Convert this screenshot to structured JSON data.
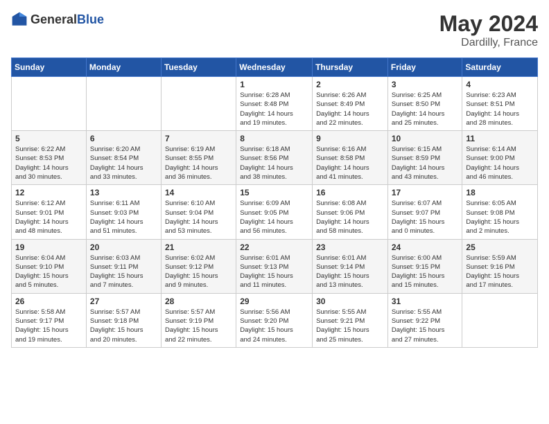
{
  "logo": {
    "general": "General",
    "blue": "Blue"
  },
  "title": {
    "month": "May 2024",
    "location": "Dardilly, France"
  },
  "weekdays": [
    "Sunday",
    "Monday",
    "Tuesday",
    "Wednesday",
    "Thursday",
    "Friday",
    "Saturday"
  ],
  "weeks": [
    [
      {
        "day": "",
        "info": ""
      },
      {
        "day": "",
        "info": ""
      },
      {
        "day": "",
        "info": ""
      },
      {
        "day": "1",
        "info": "Sunrise: 6:28 AM\nSunset: 8:48 PM\nDaylight: 14 hours\nand 19 minutes."
      },
      {
        "day": "2",
        "info": "Sunrise: 6:26 AM\nSunset: 8:49 PM\nDaylight: 14 hours\nand 22 minutes."
      },
      {
        "day": "3",
        "info": "Sunrise: 6:25 AM\nSunset: 8:50 PM\nDaylight: 14 hours\nand 25 minutes."
      },
      {
        "day": "4",
        "info": "Sunrise: 6:23 AM\nSunset: 8:51 PM\nDaylight: 14 hours\nand 28 minutes."
      }
    ],
    [
      {
        "day": "5",
        "info": "Sunrise: 6:22 AM\nSunset: 8:53 PM\nDaylight: 14 hours\nand 30 minutes."
      },
      {
        "day": "6",
        "info": "Sunrise: 6:20 AM\nSunset: 8:54 PM\nDaylight: 14 hours\nand 33 minutes."
      },
      {
        "day": "7",
        "info": "Sunrise: 6:19 AM\nSunset: 8:55 PM\nDaylight: 14 hours\nand 36 minutes."
      },
      {
        "day": "8",
        "info": "Sunrise: 6:18 AM\nSunset: 8:56 PM\nDaylight: 14 hours\nand 38 minutes."
      },
      {
        "day": "9",
        "info": "Sunrise: 6:16 AM\nSunset: 8:58 PM\nDaylight: 14 hours\nand 41 minutes."
      },
      {
        "day": "10",
        "info": "Sunrise: 6:15 AM\nSunset: 8:59 PM\nDaylight: 14 hours\nand 43 minutes."
      },
      {
        "day": "11",
        "info": "Sunrise: 6:14 AM\nSunset: 9:00 PM\nDaylight: 14 hours\nand 46 minutes."
      }
    ],
    [
      {
        "day": "12",
        "info": "Sunrise: 6:12 AM\nSunset: 9:01 PM\nDaylight: 14 hours\nand 48 minutes."
      },
      {
        "day": "13",
        "info": "Sunrise: 6:11 AM\nSunset: 9:03 PM\nDaylight: 14 hours\nand 51 minutes."
      },
      {
        "day": "14",
        "info": "Sunrise: 6:10 AM\nSunset: 9:04 PM\nDaylight: 14 hours\nand 53 minutes."
      },
      {
        "day": "15",
        "info": "Sunrise: 6:09 AM\nSunset: 9:05 PM\nDaylight: 14 hours\nand 56 minutes."
      },
      {
        "day": "16",
        "info": "Sunrise: 6:08 AM\nSunset: 9:06 PM\nDaylight: 14 hours\nand 58 minutes."
      },
      {
        "day": "17",
        "info": "Sunrise: 6:07 AM\nSunset: 9:07 PM\nDaylight: 15 hours\nand 0 minutes."
      },
      {
        "day": "18",
        "info": "Sunrise: 6:05 AM\nSunset: 9:08 PM\nDaylight: 15 hours\nand 2 minutes."
      }
    ],
    [
      {
        "day": "19",
        "info": "Sunrise: 6:04 AM\nSunset: 9:10 PM\nDaylight: 15 hours\nand 5 minutes."
      },
      {
        "day": "20",
        "info": "Sunrise: 6:03 AM\nSunset: 9:11 PM\nDaylight: 15 hours\nand 7 minutes."
      },
      {
        "day": "21",
        "info": "Sunrise: 6:02 AM\nSunset: 9:12 PM\nDaylight: 15 hours\nand 9 minutes."
      },
      {
        "day": "22",
        "info": "Sunrise: 6:01 AM\nSunset: 9:13 PM\nDaylight: 15 hours\nand 11 minutes."
      },
      {
        "day": "23",
        "info": "Sunrise: 6:01 AM\nSunset: 9:14 PM\nDaylight: 15 hours\nand 13 minutes."
      },
      {
        "day": "24",
        "info": "Sunrise: 6:00 AM\nSunset: 9:15 PM\nDaylight: 15 hours\nand 15 minutes."
      },
      {
        "day": "25",
        "info": "Sunrise: 5:59 AM\nSunset: 9:16 PM\nDaylight: 15 hours\nand 17 minutes."
      }
    ],
    [
      {
        "day": "26",
        "info": "Sunrise: 5:58 AM\nSunset: 9:17 PM\nDaylight: 15 hours\nand 19 minutes."
      },
      {
        "day": "27",
        "info": "Sunrise: 5:57 AM\nSunset: 9:18 PM\nDaylight: 15 hours\nand 20 minutes."
      },
      {
        "day": "28",
        "info": "Sunrise: 5:57 AM\nSunset: 9:19 PM\nDaylight: 15 hours\nand 22 minutes."
      },
      {
        "day": "29",
        "info": "Sunrise: 5:56 AM\nSunset: 9:20 PM\nDaylight: 15 hours\nand 24 minutes."
      },
      {
        "day": "30",
        "info": "Sunrise: 5:55 AM\nSunset: 9:21 PM\nDaylight: 15 hours\nand 25 minutes."
      },
      {
        "day": "31",
        "info": "Sunrise: 5:55 AM\nSunset: 9:22 PM\nDaylight: 15 hours\nand 27 minutes."
      },
      {
        "day": "",
        "info": ""
      }
    ]
  ]
}
